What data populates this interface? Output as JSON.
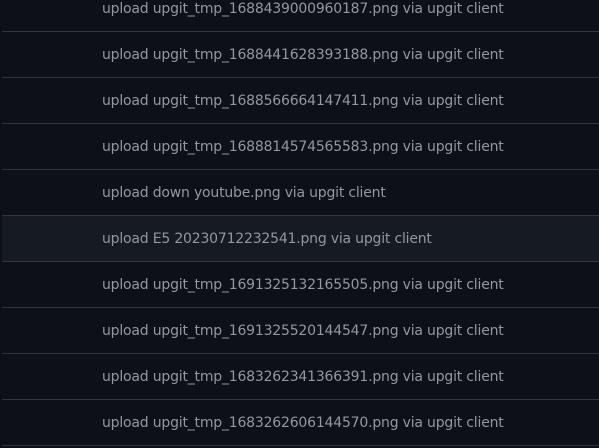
{
  "commits": [
    {
      "message": "upload upgit_tmp_1688439000960187.png via upgit client",
      "highlighted": false
    },
    {
      "message": "upload upgit_tmp_1688441628393188.png via upgit client",
      "highlighted": false
    },
    {
      "message": "upload upgit_tmp_1688566664147411.png via upgit client",
      "highlighted": false
    },
    {
      "message": "upload upgit_tmp_1688814574565583.png via upgit client",
      "highlighted": false
    },
    {
      "message": "upload down youtube.png via upgit client",
      "highlighted": false
    },
    {
      "message": "upload E5 20230712232541.png via upgit client",
      "highlighted": true
    },
    {
      "message": "upload upgit_tmp_1691325132165505.png via upgit client",
      "highlighted": false
    },
    {
      "message": "upload upgit_tmp_1691325520144547.png via upgit client",
      "highlighted": false
    },
    {
      "message": "upload upgit_tmp_1683262341366391.png via upgit client",
      "highlighted": false
    },
    {
      "message": "upload upgit_tmp_1683262606144570.png via upgit client",
      "highlighted": false
    }
  ],
  "colors": {
    "background": "#0d1117",
    "highlight": "#161b22",
    "border": "#30363d",
    "text": "#9198a1"
  }
}
